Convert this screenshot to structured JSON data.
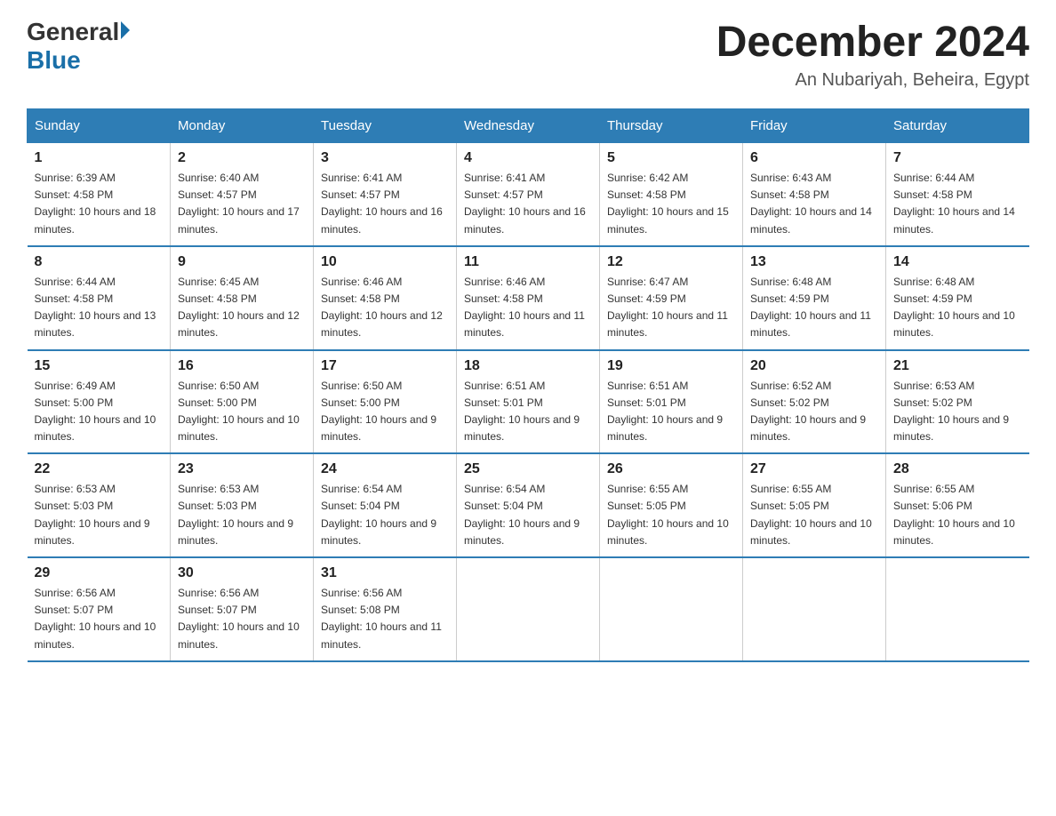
{
  "logo": {
    "general": "General",
    "blue": "Blue",
    "triangle": "▶"
  },
  "title": {
    "month": "December 2024",
    "location": "An Nubariyah, Beheira, Egypt"
  },
  "days_of_week": [
    "Sunday",
    "Monday",
    "Tuesday",
    "Wednesday",
    "Thursday",
    "Friday",
    "Saturday"
  ],
  "weeks": [
    [
      {
        "num": "1",
        "sunrise": "6:39 AM",
        "sunset": "4:58 PM",
        "daylight": "10 hours and 18 minutes."
      },
      {
        "num": "2",
        "sunrise": "6:40 AM",
        "sunset": "4:57 PM",
        "daylight": "10 hours and 17 minutes."
      },
      {
        "num": "3",
        "sunrise": "6:41 AM",
        "sunset": "4:57 PM",
        "daylight": "10 hours and 16 minutes."
      },
      {
        "num": "4",
        "sunrise": "6:41 AM",
        "sunset": "4:57 PM",
        "daylight": "10 hours and 16 minutes."
      },
      {
        "num": "5",
        "sunrise": "6:42 AM",
        "sunset": "4:58 PM",
        "daylight": "10 hours and 15 minutes."
      },
      {
        "num": "6",
        "sunrise": "6:43 AM",
        "sunset": "4:58 PM",
        "daylight": "10 hours and 14 minutes."
      },
      {
        "num": "7",
        "sunrise": "6:44 AM",
        "sunset": "4:58 PM",
        "daylight": "10 hours and 14 minutes."
      }
    ],
    [
      {
        "num": "8",
        "sunrise": "6:44 AM",
        "sunset": "4:58 PM",
        "daylight": "10 hours and 13 minutes."
      },
      {
        "num": "9",
        "sunrise": "6:45 AM",
        "sunset": "4:58 PM",
        "daylight": "10 hours and 12 minutes."
      },
      {
        "num": "10",
        "sunrise": "6:46 AM",
        "sunset": "4:58 PM",
        "daylight": "10 hours and 12 minutes."
      },
      {
        "num": "11",
        "sunrise": "6:46 AM",
        "sunset": "4:58 PM",
        "daylight": "10 hours and 11 minutes."
      },
      {
        "num": "12",
        "sunrise": "6:47 AM",
        "sunset": "4:59 PM",
        "daylight": "10 hours and 11 minutes."
      },
      {
        "num": "13",
        "sunrise": "6:48 AM",
        "sunset": "4:59 PM",
        "daylight": "10 hours and 11 minutes."
      },
      {
        "num": "14",
        "sunrise": "6:48 AM",
        "sunset": "4:59 PM",
        "daylight": "10 hours and 10 minutes."
      }
    ],
    [
      {
        "num": "15",
        "sunrise": "6:49 AM",
        "sunset": "5:00 PM",
        "daylight": "10 hours and 10 minutes."
      },
      {
        "num": "16",
        "sunrise": "6:50 AM",
        "sunset": "5:00 PM",
        "daylight": "10 hours and 10 minutes."
      },
      {
        "num": "17",
        "sunrise": "6:50 AM",
        "sunset": "5:00 PM",
        "daylight": "10 hours and 9 minutes."
      },
      {
        "num": "18",
        "sunrise": "6:51 AM",
        "sunset": "5:01 PM",
        "daylight": "10 hours and 9 minutes."
      },
      {
        "num": "19",
        "sunrise": "6:51 AM",
        "sunset": "5:01 PM",
        "daylight": "10 hours and 9 minutes."
      },
      {
        "num": "20",
        "sunrise": "6:52 AM",
        "sunset": "5:02 PM",
        "daylight": "10 hours and 9 minutes."
      },
      {
        "num": "21",
        "sunrise": "6:53 AM",
        "sunset": "5:02 PM",
        "daylight": "10 hours and 9 minutes."
      }
    ],
    [
      {
        "num": "22",
        "sunrise": "6:53 AM",
        "sunset": "5:03 PM",
        "daylight": "10 hours and 9 minutes."
      },
      {
        "num": "23",
        "sunrise": "6:53 AM",
        "sunset": "5:03 PM",
        "daylight": "10 hours and 9 minutes."
      },
      {
        "num": "24",
        "sunrise": "6:54 AM",
        "sunset": "5:04 PM",
        "daylight": "10 hours and 9 minutes."
      },
      {
        "num": "25",
        "sunrise": "6:54 AM",
        "sunset": "5:04 PM",
        "daylight": "10 hours and 9 minutes."
      },
      {
        "num": "26",
        "sunrise": "6:55 AM",
        "sunset": "5:05 PM",
        "daylight": "10 hours and 10 minutes."
      },
      {
        "num": "27",
        "sunrise": "6:55 AM",
        "sunset": "5:05 PM",
        "daylight": "10 hours and 10 minutes."
      },
      {
        "num": "28",
        "sunrise": "6:55 AM",
        "sunset": "5:06 PM",
        "daylight": "10 hours and 10 minutes."
      }
    ],
    [
      {
        "num": "29",
        "sunrise": "6:56 AM",
        "sunset": "5:07 PM",
        "daylight": "10 hours and 10 minutes."
      },
      {
        "num": "30",
        "sunrise": "6:56 AM",
        "sunset": "5:07 PM",
        "daylight": "10 hours and 10 minutes."
      },
      {
        "num": "31",
        "sunrise": "6:56 AM",
        "sunset": "5:08 PM",
        "daylight": "10 hours and 11 minutes."
      },
      null,
      null,
      null,
      null
    ]
  ]
}
